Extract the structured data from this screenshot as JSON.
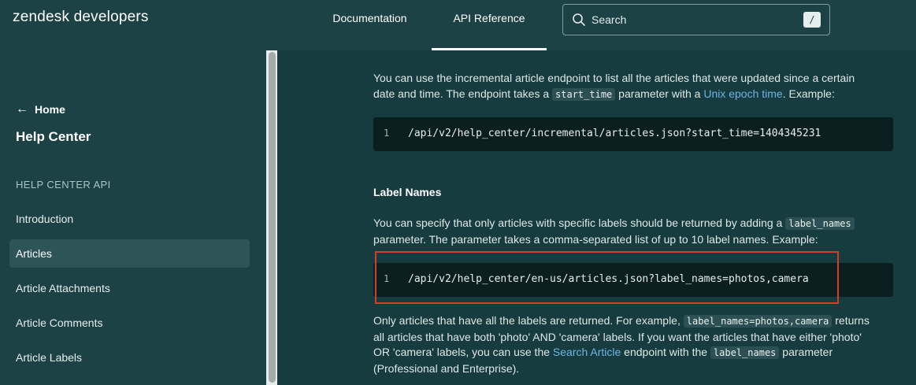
{
  "header": {
    "logo": "zendesk developers",
    "nav": [
      "Documentation",
      "API Reference"
    ],
    "active_nav": "API Reference",
    "search": {
      "placeholder": "Search",
      "shortcut": "/"
    }
  },
  "sidebar": {
    "home_label": "Home",
    "section_title": "Help Center",
    "group_label": "HELP CENTER API",
    "items": [
      {
        "label": "Introduction",
        "active": false
      },
      {
        "label": "Articles",
        "active": true
      },
      {
        "label": "Article Attachments",
        "active": false
      },
      {
        "label": "Article Comments",
        "active": false
      },
      {
        "label": "Article Labels",
        "active": false
      }
    ]
  },
  "main": {
    "para1": {
      "t1": "You can use the incremental article endpoint to list all the articles that were updated since a certain",
      "t2": "date and time. The endpoint takes a ",
      "code": "start_time",
      "t3": " parameter with a ",
      "link": "Unix epoch time",
      "t4": ". Example:"
    },
    "code1": {
      "line": "1",
      "text": "/api/v2/help_center/incremental/articles.json?start_time=1404345231"
    },
    "heading": "Label Names",
    "para2": {
      "t1": "You can specify that only articles with specific labels should be returned by adding a ",
      "code": "label_names",
      "t2": "parameter. The parameter takes a comma-separated list of up to 10 label names. Example:"
    },
    "code2": {
      "line": "1",
      "text": "/api/v2/help_center/en-us/articles.json?label_names=photos,camera"
    },
    "para3": {
      "t1": "Only articles that have all the labels are returned. For example, ",
      "code1": "label_names=photos,camera",
      "t2": " returns",
      "t3": "all articles that have both 'photo' AND 'camera' labels. If you want the articles that have either 'photo'",
      "t4": "OR 'camera' labels, you can use the ",
      "link": "Search Article",
      "t5": " endpoint with the ",
      "code2": "label_names",
      "t6": " parameter",
      "t7": "(Professional and Enterprise)."
    }
  },
  "colors": {
    "header_bg": "#1d4245",
    "content_bg": "#173c3f",
    "link": "#6fb3e5",
    "highlight": "#d43d2a"
  }
}
